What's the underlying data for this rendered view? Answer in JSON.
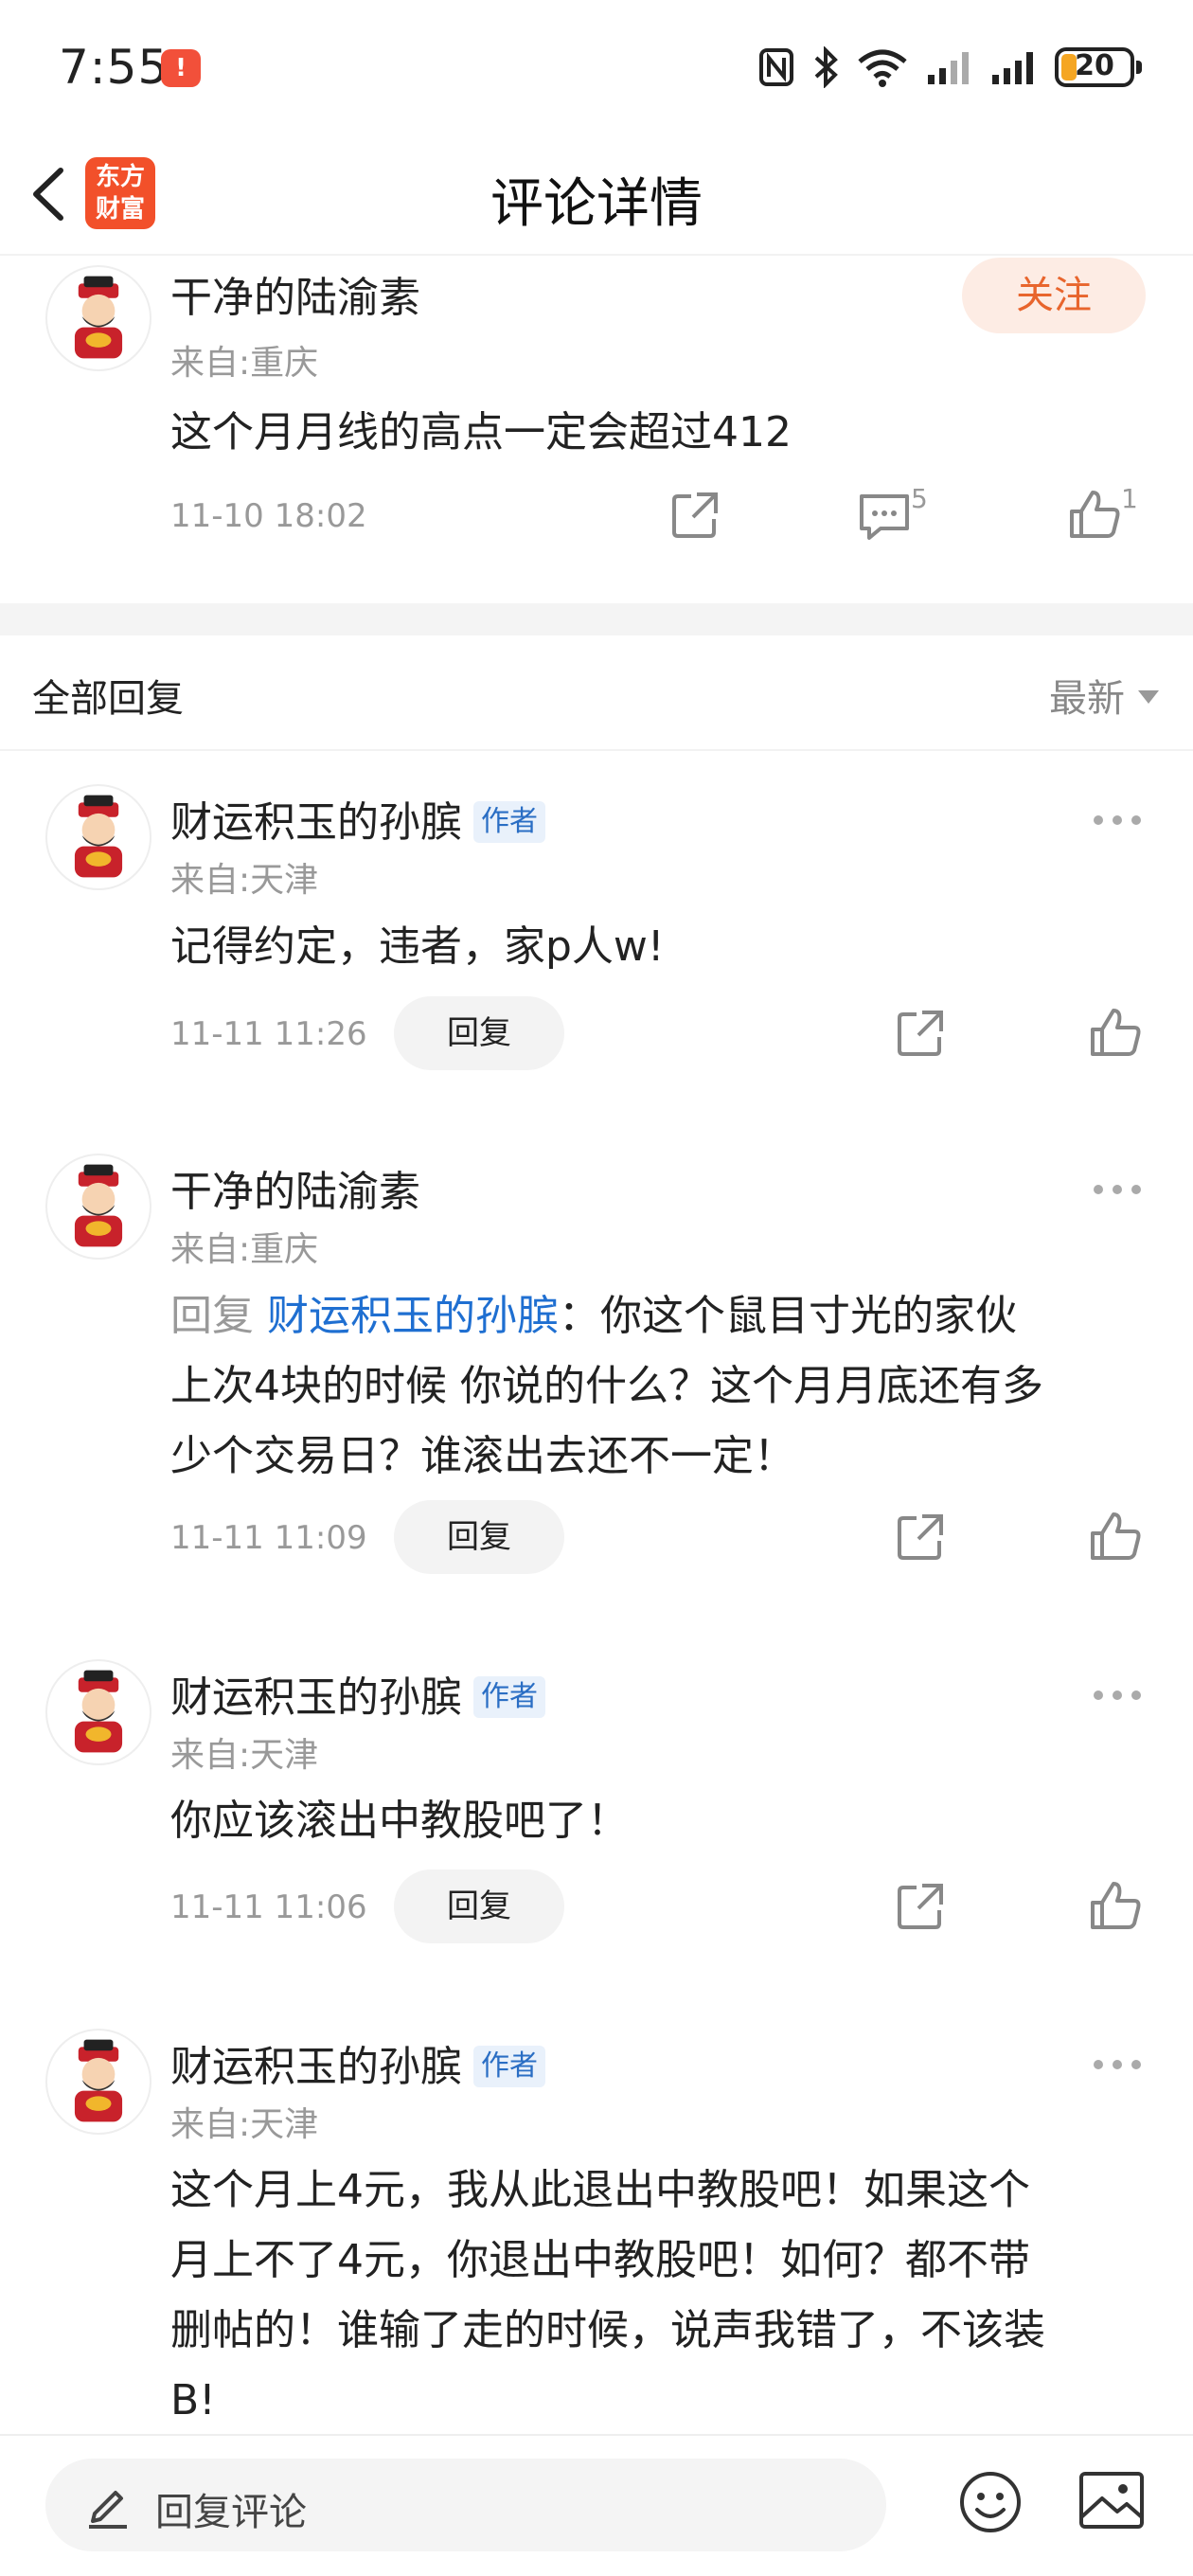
{
  "status_bar": {
    "time": "7:55",
    "notification_badge": "!",
    "battery": "20"
  },
  "nav": {
    "title": "评论详情",
    "logo_line1": "东方",
    "logo_line2": "财富"
  },
  "main_comment": {
    "name": "干净的陆渝素",
    "location": "来自:重庆",
    "content": "这个月月线的高点一定会超过412",
    "time": "11-10 18:02",
    "follow_label": "关注",
    "comment_count": "5",
    "like_count": "1"
  },
  "replies_header": {
    "title": "全部回复",
    "sort_label": "最新"
  },
  "replies": [
    {
      "name": "财运积玉的孙膑",
      "badge": "作者",
      "location": "来自:天津",
      "content": "记得约定，违者，家p人w!",
      "time": "11-11 11:26",
      "reply_label": "回复"
    },
    {
      "name": "干净的陆渝素",
      "location": "来自:重庆",
      "reply_prefix": "回复 ",
      "mention": "财运积玉的孙膑",
      "content_line1": "：你这个鼠目寸光的家伙",
      "content_line2": "上次4块的时候 你说的什么？这个月月底还有多",
      "content_line3": "少个交易日？谁滚出去还不一定！",
      "time": "11-11 11:09",
      "reply_label": "回复"
    },
    {
      "name": "财运积玉的孙膑",
      "badge": "作者",
      "location": "来自:天津",
      "content": "你应该滚出中教股吧了！",
      "time": "11-11 11:06",
      "reply_label": "回复"
    },
    {
      "name": "财运积玉的孙膑",
      "badge": "作者",
      "location": "来自:天津",
      "content_line1": "这个月上4元，我从此退出中教股吧！如果这个",
      "content_line2": "月上不了4元，你退出中教股吧！如何？都不带",
      "content_line3": "删帖的！谁输了走的时候，说声我错了，不该装",
      "content_line4": "B!"
    }
  ],
  "bottom_bar": {
    "input_placeholder": "回复评论"
  },
  "colors": {
    "accent_orange": "#e8652d",
    "mention_blue": "#1f6fd1",
    "logo_red": "#f2502a"
  }
}
